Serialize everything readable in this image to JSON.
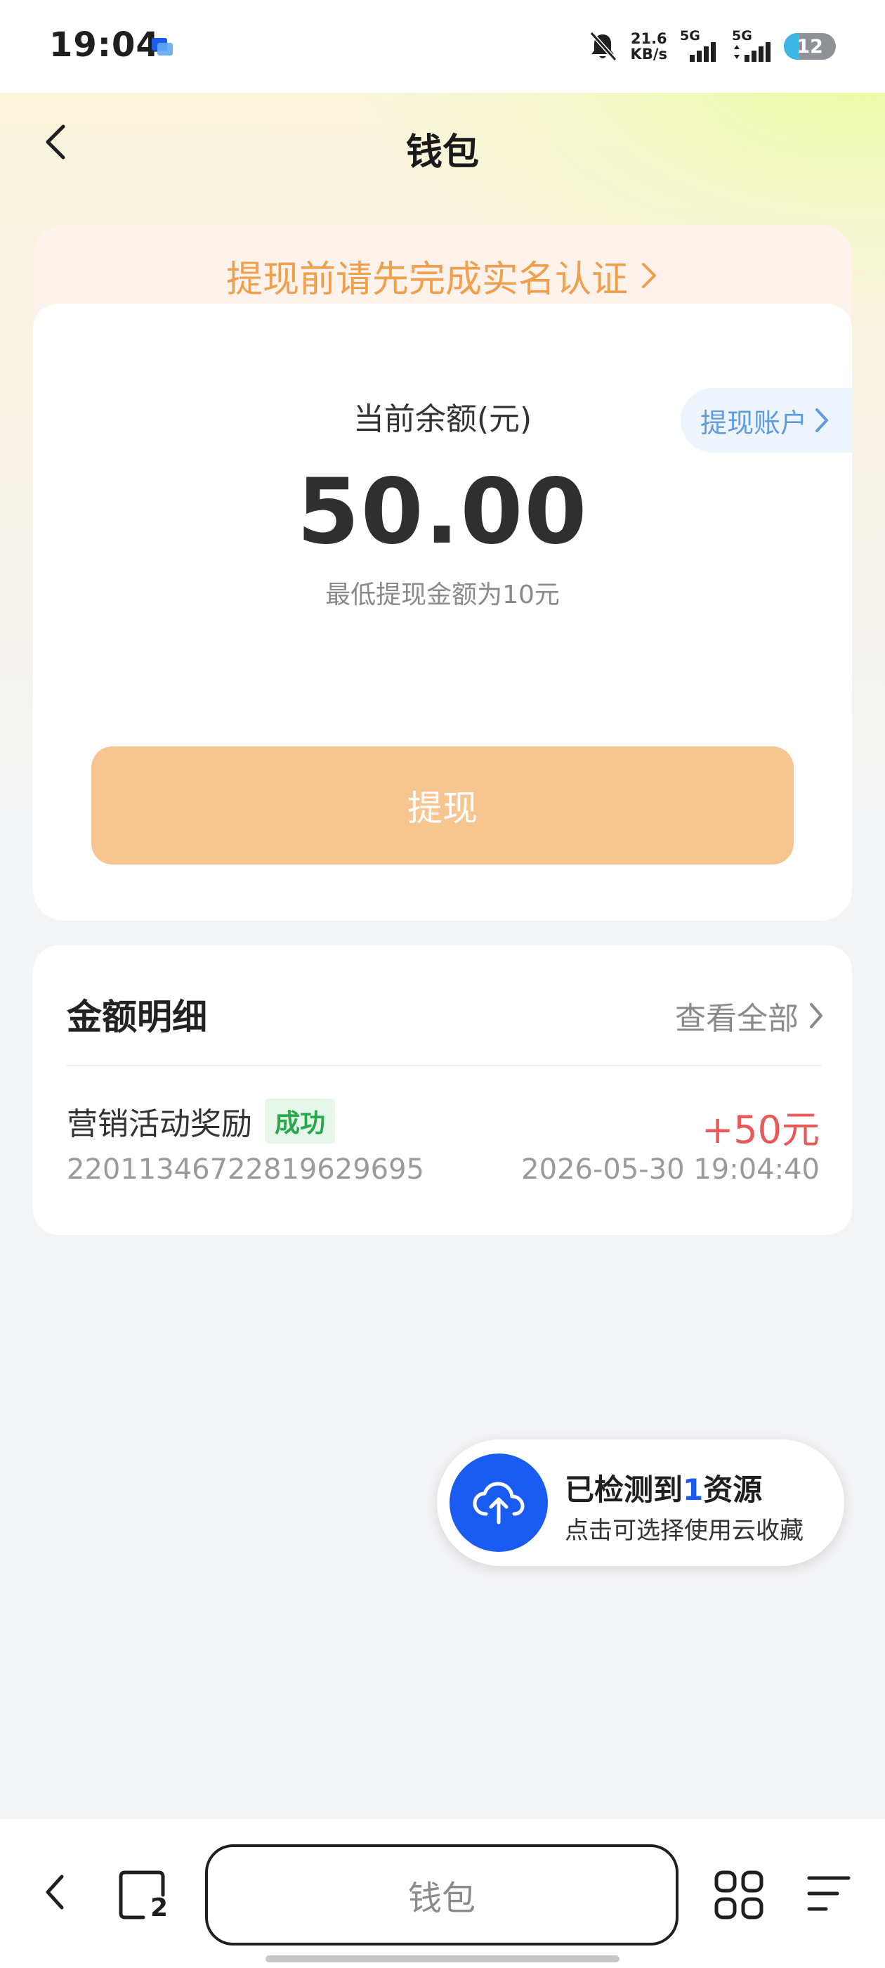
{
  "status_bar": {
    "time": "19:04",
    "net_speed_value": "21.6",
    "net_speed_unit": "KB/s",
    "sim1_label": "5G",
    "sim2_label": "5G",
    "battery_level": "12",
    "battery_fraction": 0.12
  },
  "nav": {
    "title": "钱包"
  },
  "notice": {
    "text": "提现前请先完成实名认证"
  },
  "balance": {
    "label": "当前余额(元)",
    "amount": "50.00",
    "min_note": "最低提现金额为10元",
    "account_link": "提现账户"
  },
  "withdraw_button": {
    "label": "提现"
  },
  "details": {
    "title": "金额明细",
    "view_all": "查看全部",
    "items": [
      {
        "title": "营销活动奖励",
        "status": "成功",
        "amount": "+50元",
        "id": "22011346722819629695",
        "time": "2026-05-30 19:04:40"
      }
    ]
  },
  "cloud_toast": {
    "prefix": "已检测到",
    "count": "1",
    "suffix": "资源",
    "subtitle": "点击可选择使用云收藏"
  },
  "bottom_bar": {
    "address_text": "钱包",
    "tab_count": "2"
  },
  "colors": {
    "accent_orange": "#f0a04c",
    "button_orange": "#f7c590",
    "success_green": "#27a84a",
    "amount_red": "#e85a5a",
    "cloud_blue": "#1a5cf2",
    "link_blue": "#5e9be0"
  },
  "icons": {
    "back": "chevron-left-icon",
    "notice_arrow": "chevron-right-icon",
    "cloud": "cloud-upload-icon",
    "tabs": "tabs-icon",
    "grid": "grid-icon",
    "menu": "menu-icon",
    "mute": "bell-off-icon"
  }
}
